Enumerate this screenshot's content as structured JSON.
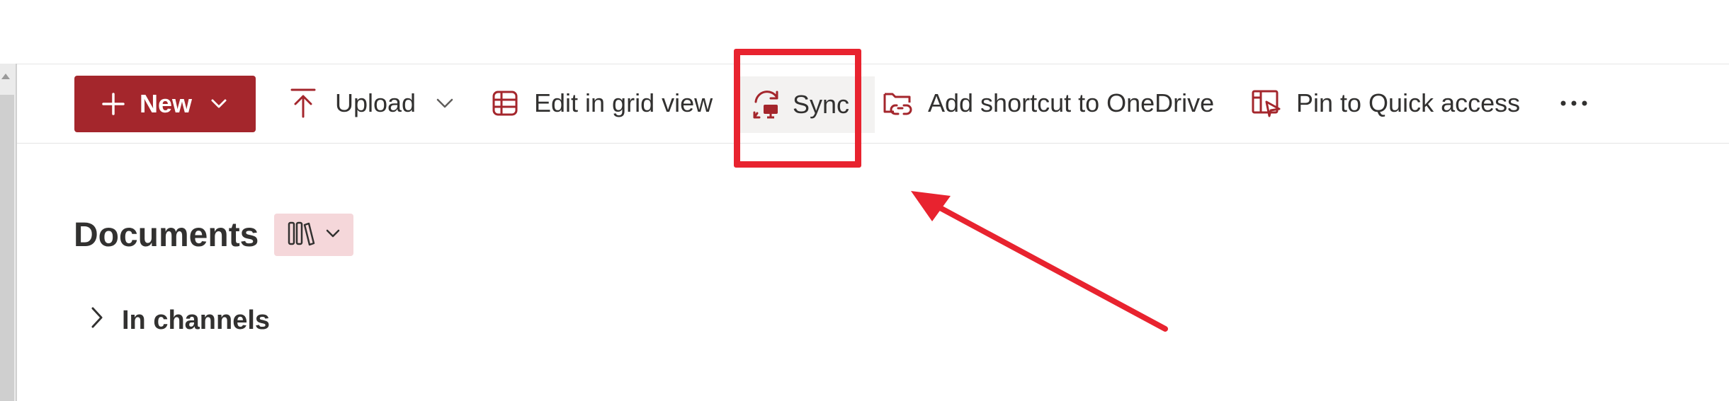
{
  "toolbar": {
    "new_label": "New",
    "upload_label": "Upload",
    "grid_label": "Edit in grid view",
    "sync_label": "Sync",
    "shortcut_label": "Add shortcut to OneDrive",
    "pin_label": "Pin to Quick access",
    "more_label": "···"
  },
  "library": {
    "title": "Documents"
  },
  "tree": {
    "channels_label": "In channels"
  },
  "colors": {
    "accent": "#a4262c",
    "annotation": "#e8232f",
    "view_button_bg": "#f5d7da",
    "hover_bg": "#f3f2f1"
  },
  "icons": {
    "new": "plus-icon",
    "upload": "upload-icon",
    "grid": "grid-view-icon",
    "sync": "sync-icon",
    "shortcut": "add-shortcut-icon",
    "pin": "pin-icon",
    "more": "more-icon",
    "view": "library-view-icon",
    "expand": "chevron-right-icon"
  }
}
